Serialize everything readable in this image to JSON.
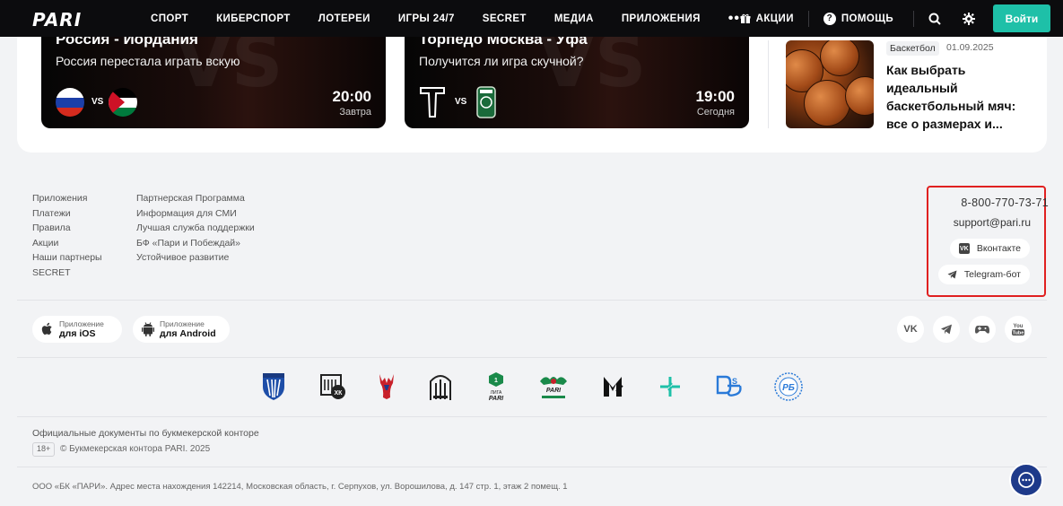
{
  "header": {
    "logo": "PARI",
    "nav": [
      "СПОРТ",
      "КИБЕРСПОРТ",
      "ЛОТЕРЕИ",
      "ИГРЫ 24/7",
      "SECRET",
      "МЕДИА",
      "ПРИЛОЖЕНИЯ"
    ],
    "more": "•••",
    "promo": "АКЦИИ",
    "help": "ПОМОЩЬ",
    "login": "Войти"
  },
  "matches": [
    {
      "title": "Россия - Иордания",
      "subtitle": "Россия перестала играть вскую",
      "vs": "VS",
      "time": "20:00",
      "day": "Завтра"
    },
    {
      "title": "Торпедо Москва - Уфа",
      "subtitle": "Получится ли игра скучной?",
      "vs": "VS",
      "time": "19:00",
      "day": "Сегодня"
    }
  ],
  "news": {
    "tag": "Баскетбол",
    "date": "01.09.2025",
    "title": "Как выбрать идеальный баскетбольный мяч: все о размерах и..."
  },
  "footer": {
    "col1": [
      "Приложения",
      "Платежи",
      "Правила",
      "Акции",
      "Наши партнеры",
      "SECRET"
    ],
    "col2": [
      "Партнерская Программа",
      "Информация для СМИ",
      "Лучшая служба поддержки",
      "БФ «Пари и Побеждай»",
      "Устойчивое развитие"
    ],
    "phone": "8-800-770-73-71",
    "email": "support@pari.ru",
    "vk": "Вконтакте",
    "telegram": "Telegram-бот",
    "app_ios_small": "Приложение",
    "app_ios_big": "для iOS",
    "app_android_small": "Приложение",
    "app_android_big": "для Android",
    "docs": "Официальные документы по букмекерской конторе",
    "age": "18+",
    "copyright": "© Букмекерская контора PARI. 2025",
    "legal": "ООО «БК «ПАРИ». Адрес места нахождения 142214, Московская область, г. Серпухов, ул. Ворошилова, д. 147 стр. 1, этаж 2 помещ. 1"
  },
  "colors": {
    "accent": "#1ec0a8",
    "header": "#0c0c0e",
    "highlight": "#e02020",
    "chat": "#1e3a8a"
  }
}
